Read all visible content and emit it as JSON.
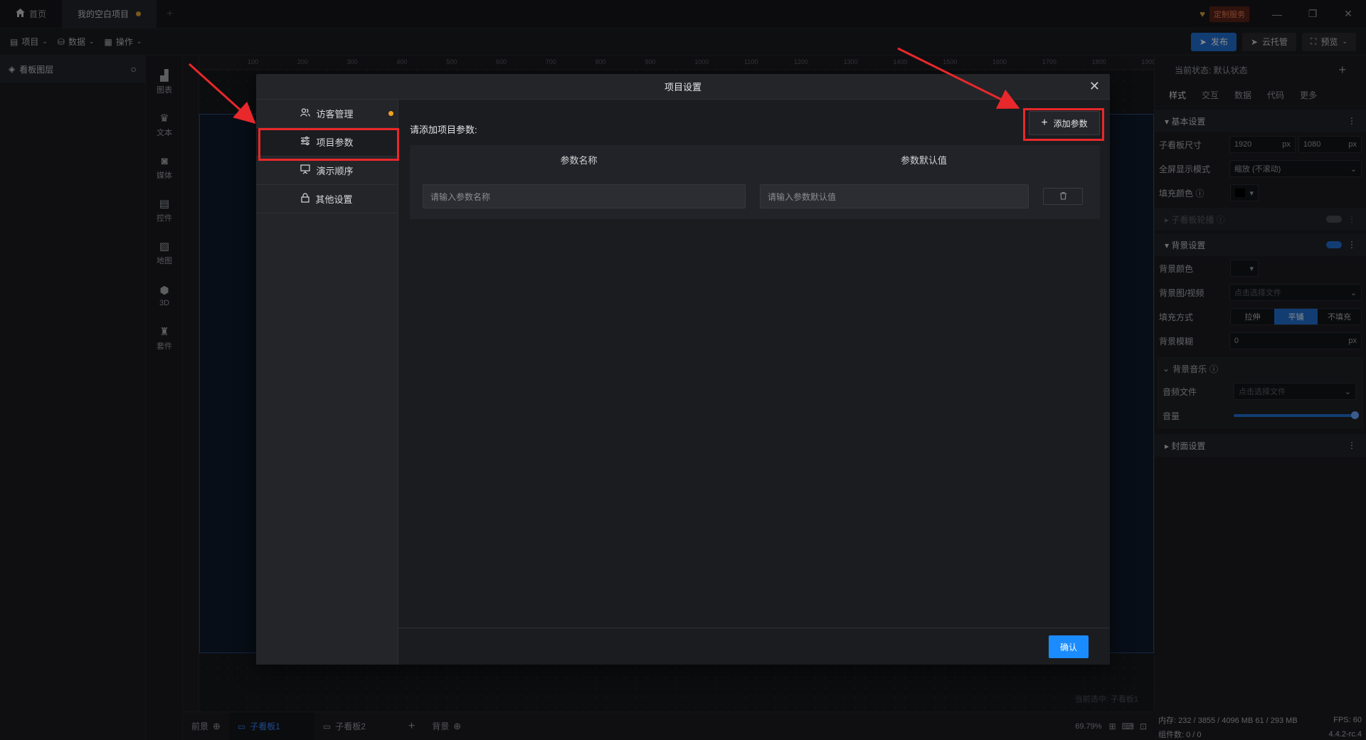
{
  "titlebar": {
    "tabs": [
      {
        "label": "首页"
      },
      {
        "label": "我的空白项目"
      }
    ],
    "service_badge": "定制服务"
  },
  "menubar": {
    "items": [
      {
        "label": "项目"
      },
      {
        "label": "数据"
      },
      {
        "label": "操作"
      }
    ],
    "publish": "发布",
    "cloud": "云托管",
    "preview": "预览"
  },
  "layers": {
    "title": "看板图层"
  },
  "components": [
    {
      "label": "图表",
      "icon": "chart-icon"
    },
    {
      "label": "文本",
      "icon": "text-icon"
    },
    {
      "label": "媒体",
      "icon": "media-icon"
    },
    {
      "label": "控件",
      "icon": "widget-icon"
    },
    {
      "label": "地图",
      "icon": "map-icon"
    },
    {
      "label": "3D",
      "icon": "cube-icon"
    },
    {
      "label": "套件",
      "icon": "kit-icon"
    }
  ],
  "ruler": {
    "ticks": [
      "100",
      "200",
      "300",
      "400",
      "500",
      "600",
      "700",
      "800",
      "900",
      "1000",
      "1100",
      "1200",
      "1300",
      "1400",
      "1500",
      "1600",
      "1700",
      "1800",
      "1900"
    ]
  },
  "canvas": {
    "current_selection": "当前选中: 子看板1"
  },
  "bottombar": {
    "foreground": "前景",
    "board1": "子看板1",
    "board2": "子看板2",
    "background": "背景",
    "zoom": "69.79%"
  },
  "rightpanel": {
    "state": "当前状态: 默认状态",
    "tabs": [
      "样式",
      "交互",
      "数据",
      "代码",
      "更多"
    ],
    "basic_section": "基本设置",
    "board_size_label": "子看板尺寸",
    "width": "1920",
    "height": "1080",
    "unit": "px",
    "fullscreen_label": "全屏显示模式",
    "fullscreen_value": "缩放 (不滚动)",
    "fill_color_label": "填充颜色",
    "carousel_section": "子看板轮播",
    "bg_section": "背景设置",
    "bg_color_label": "背景颜色",
    "bg_media_label": "背景图/视频",
    "bg_media_placeholder": "点击选择文件",
    "fill_mode_label": "填充方式",
    "fill_modes": [
      "拉伸",
      "平铺",
      "不填充"
    ],
    "blur_label": "背景模糊",
    "blur_value": "0",
    "music_section": "背景音乐",
    "audio_label": "音频文件",
    "audio_placeholder": "点击选择文件",
    "volume_label": "音量",
    "volume": 1.0,
    "cover_section": "封面设置"
  },
  "status": {
    "memory": "内存: 232 / 3855 / 4096 MB  61 / 293 MB",
    "fps": "FPS: 60",
    "components": "组件数: 0 / 0",
    "version": "4.4.2-rc.4"
  },
  "modal": {
    "title": "项目设置",
    "nav": [
      {
        "label": "访客管理",
        "icon": "visitor-icon"
      },
      {
        "label": "项目参数",
        "icon": "sliders-icon"
      },
      {
        "label": "演示顺序",
        "icon": "presentation-icon"
      },
      {
        "label": "其他设置",
        "icon": "lock-icon"
      }
    ],
    "prompt": "请添加项目参数:",
    "add_button": "添加参数",
    "col_name": "参数名称",
    "col_default": "参数默认值",
    "name_placeholder": "请输入参数名称",
    "default_placeholder": "请输入参数默认值",
    "confirm": "确认"
  },
  "colors": {
    "accent": "#1b8cff",
    "annotation": "#e8282b",
    "dot": "#f0a020"
  }
}
